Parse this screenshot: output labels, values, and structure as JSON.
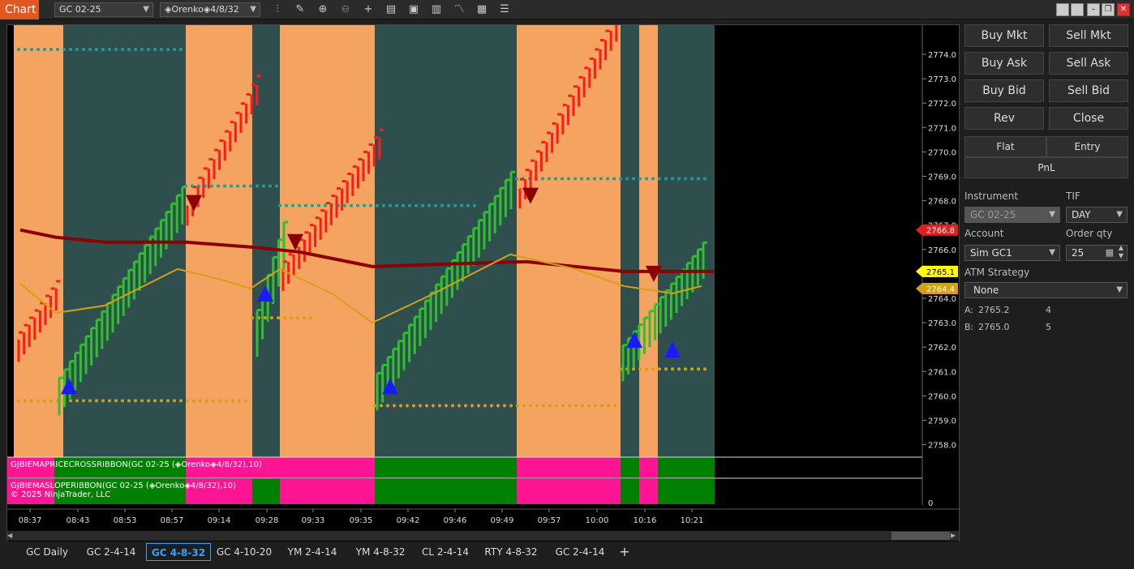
{
  "toolbar": {
    "chart_label": "Chart",
    "instrument": "GC 02-25",
    "bar_type": "◈Orenko◈4/8/32",
    "icons": [
      "bars-icon",
      "pencil-icon",
      "zoom-in-icon",
      "zoom-out-icon",
      "crosshair-icon",
      "data-box-icon",
      "indicators-icon",
      "strategies-icon",
      "drawing-tools-icon",
      "properties-icon"
    ]
  },
  "chart": {
    "price_ticks": [
      "2774.0",
      "2773.0",
      "2772.0",
      "2771.0",
      "2770.0",
      "2769.0",
      "2768.0",
      "2767.0",
      "2766.0",
      "2765.0",
      "2764.0",
      "2763.0",
      "2762.0",
      "2761.0",
      "2760.0",
      "2759.0",
      "2758.0"
    ],
    "price_markers": [
      {
        "label": "2766.8",
        "color": "#e02020",
        "price": 2766.8
      },
      {
        "label": "2765.1",
        "color": "#ffff00",
        "price": 2765.1
      },
      {
        "label": "2764.4",
        "color": "#d4a017",
        "price": 2764.4
      }
    ],
    "panel2_tick": "0",
    "time_labels": [
      "08:37",
      "08:43",
      "08:53",
      "08:57",
      "09:14",
      "09:28",
      "09:33",
      "09:35",
      "09:42",
      "09:46",
      "09:49",
      "09:57",
      "10:00",
      "10:16",
      "10:21"
    ],
    "ribbon1_label": "GJBIEMAPRICECROSSRIBBON(GC 02-25 (◈Orenko◈4/8/32),10)",
    "ribbon2_label": "GJBIEMASLOPERIBBON(GC 02-25 (◈Orenko◈4/8/32),10)",
    "copyright": "© 2025 NinjaTrader, LLC",
    "colors": {
      "bull_bar": "#2fbf2f",
      "bear_bar": "#ff1a1a",
      "bg_orange": "#f4a460",
      "bg_slate": "#2f4f4f",
      "ribbon_pink": "#ff1493",
      "ribbon_green": "#008000",
      "ema_dark": "#8b0000",
      "ema_gold": "#d4a017"
    }
  },
  "panel": {
    "buttons": [
      "Buy Mkt",
      "Sell Mkt",
      "Buy Ask",
      "Sell Ask",
      "Buy Bid",
      "Sell Bid",
      "Rev",
      "Close"
    ],
    "flat_label": "Flat",
    "entry_label": "Entry",
    "pnl_label": "PnL",
    "instrument_label": "Instrument",
    "instrument_value": "GC 02-25",
    "tif_label": "TIF",
    "tif_value": "DAY",
    "account_label": "Account",
    "account_value": "Sim GC1",
    "order_qty_label": "Order qty",
    "order_qty_value": "25",
    "atm_label": "ATM Strategy",
    "atm_value": "None",
    "ask_label": "A:",
    "ask_price": "2765.2",
    "ask_size": "4",
    "bid_label": "B:",
    "bid_price": "2765.0",
    "bid_size": "5"
  },
  "tabs": [
    "GC Daily",
    "GC 2-4-14",
    "GC 4-8-32",
    "GC 4-10-20",
    "YM 2-4-14",
    "YM 4-8-32",
    "CL 2-4-14",
    "RTY 4-8-32",
    "GC 2-4-14",
    "+"
  ],
  "active_tab": "GC 4-8-32"
}
